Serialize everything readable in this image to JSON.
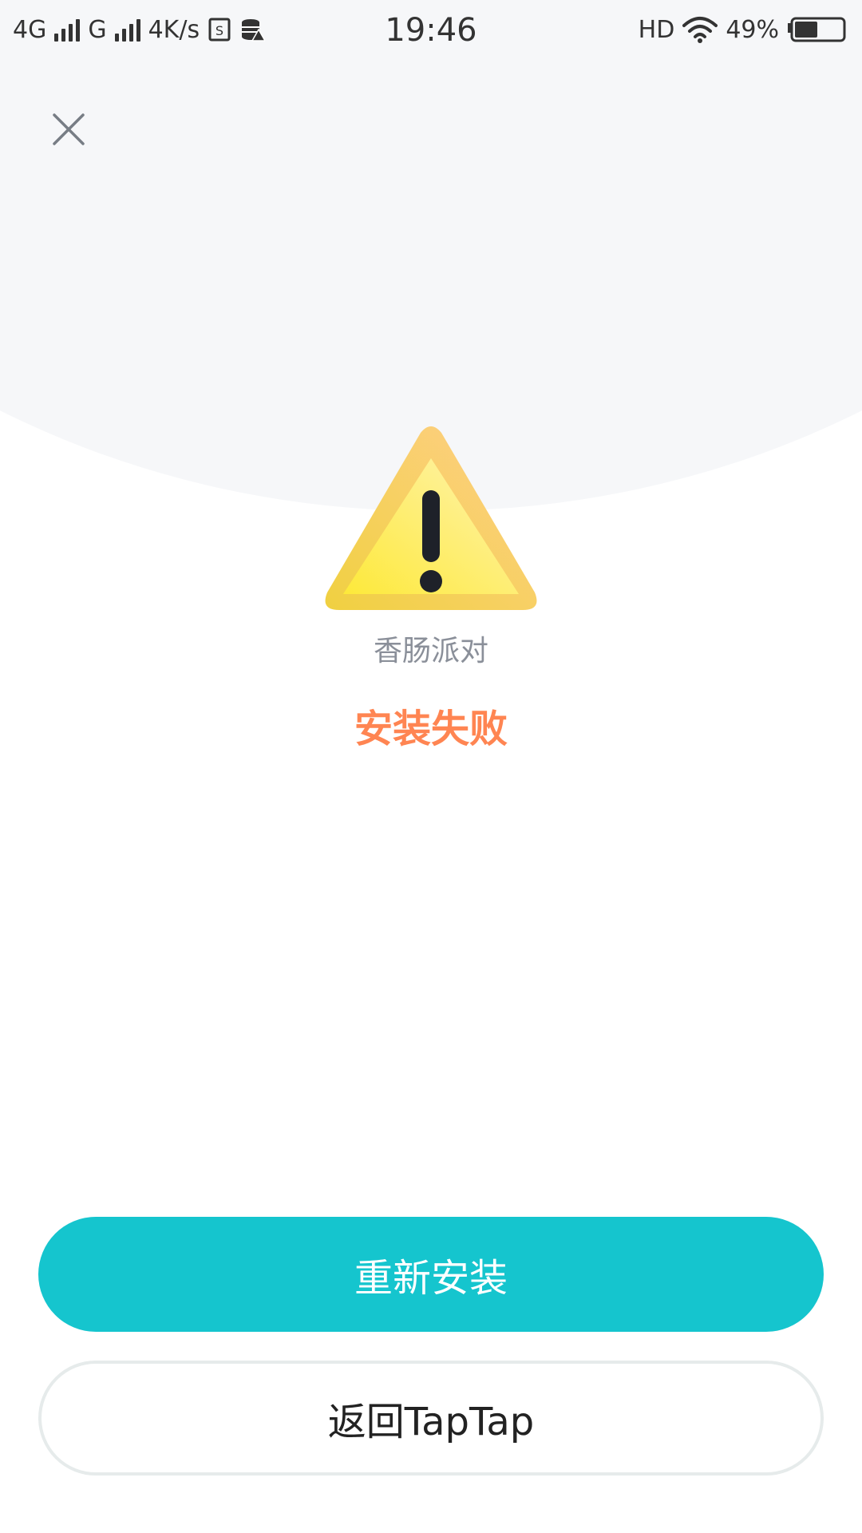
{
  "status_bar": {
    "network1": "4G",
    "network2": "G",
    "speed": "4K/s",
    "time": "19:46",
    "hd": "HD",
    "battery_percent": "49%",
    "battery_level": 0.49
  },
  "icons": {
    "close": "close-icon",
    "warning": "warning-triangle-icon"
  },
  "content": {
    "app_name": "香肠派对",
    "status_message": "安装失败"
  },
  "buttons": {
    "reinstall_label": "重新安装",
    "back_label": "返回TapTap"
  },
  "colors": {
    "accent": "#15c5ce",
    "error_text": "#ff8552",
    "muted_text": "#8a8f99",
    "warning_yellow": "#ffe84a",
    "warning_orange": "#ffcf86"
  }
}
